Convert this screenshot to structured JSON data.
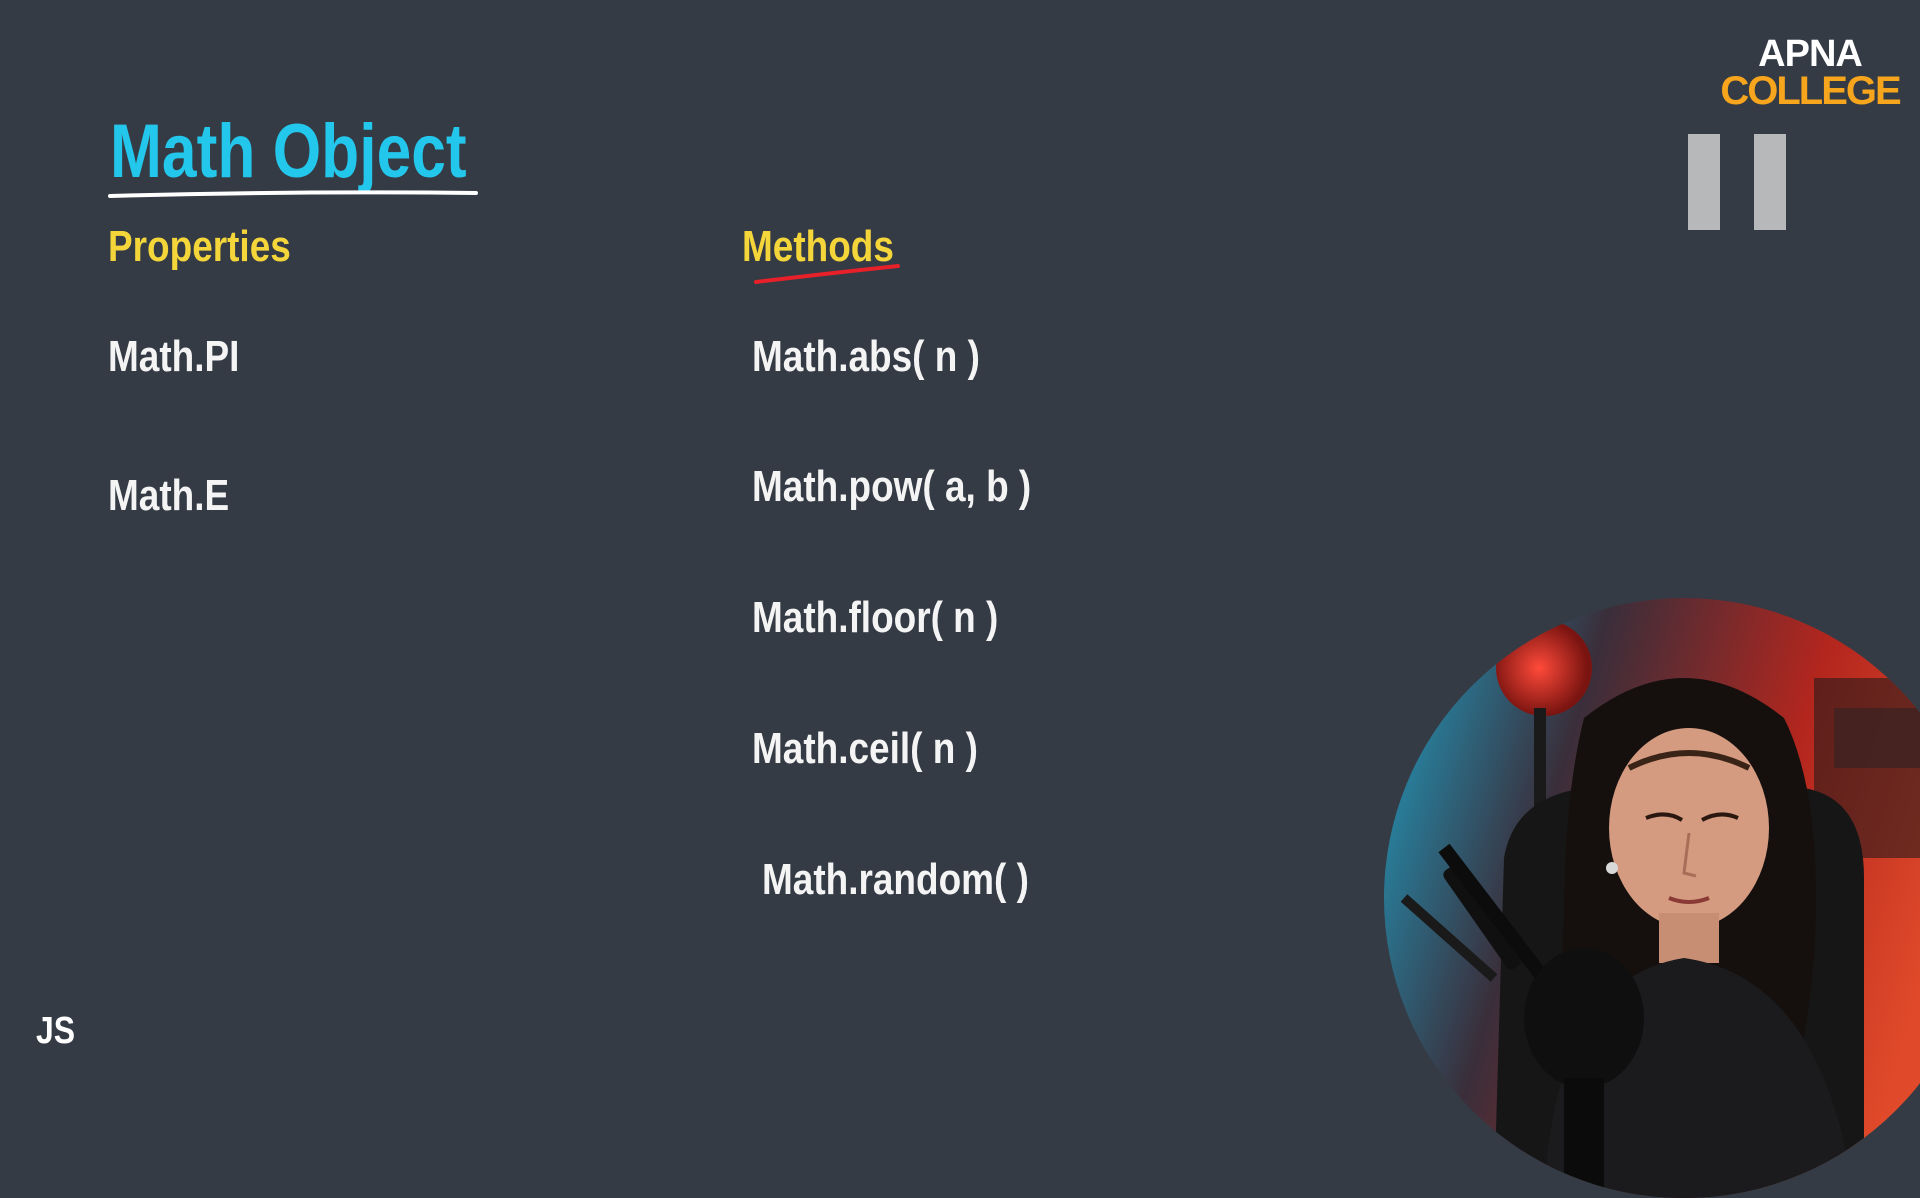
{
  "slide": {
    "title": "Math Object",
    "properties_heading": "Properties",
    "methods_heading": "Methods",
    "properties": [
      "Math.PI",
      "Math.E"
    ],
    "methods": [
      "Math.abs( n )",
      "Math.pow( a, b )",
      "Math.floor( n )",
      "Math.ceil( n )",
      "Math.random( )"
    ],
    "corner_label": "JS"
  },
  "logo": {
    "line1": "APNA",
    "line2": "COLLEGE"
  },
  "colors": {
    "background": "#343b45",
    "title": "#23c7ec",
    "heading": "#f5d63a",
    "text": "#f4f4f4",
    "methods_underline": "#e8202a",
    "logo_accent": "#f7a51c"
  },
  "icons": {
    "pause": "pause-icon"
  }
}
